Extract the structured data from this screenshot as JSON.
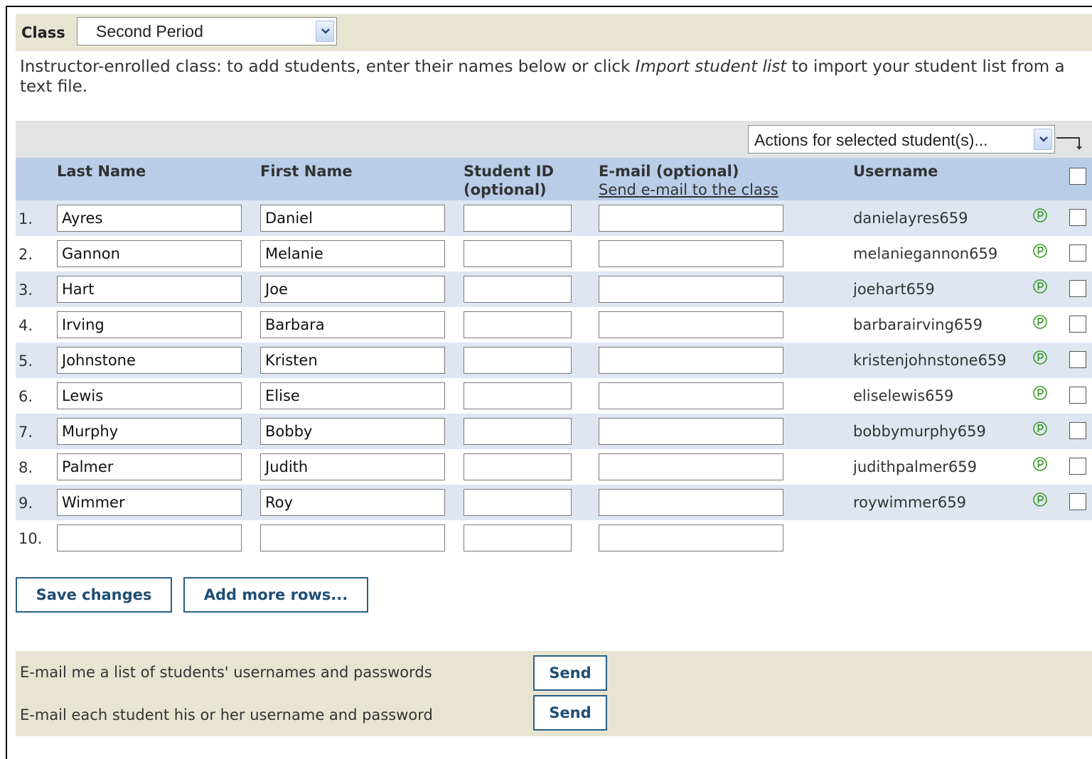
{
  "class_bar": {
    "label": "Class",
    "selected_class": "Second Period"
  },
  "intro": {
    "text_before": "Instructor-enrolled class: to add students, enter their names below or click ",
    "link_text": "Import student list",
    "text_after": " to import your student list from a text file."
  },
  "actions": {
    "select_value": "Actions for selected student(s)..."
  },
  "table": {
    "headers": {
      "last_name": "Last Name",
      "first_name": "First Name",
      "student_id_line1": "Student ID",
      "student_id_line2": "(optional)",
      "email": "E-mail (optional)",
      "send_email_link": "Send e-mail to the class",
      "username": "Username"
    },
    "rows": [
      {
        "num": "1.",
        "last": "Ayres",
        "first": "Daniel",
        "student_id": "",
        "email": "",
        "username": "danielayres659"
      },
      {
        "num": "2.",
        "last": "Gannon",
        "first": "Melanie",
        "student_id": "",
        "email": "",
        "username": "melaniegannon659"
      },
      {
        "num": "3.",
        "last": "Hart",
        "first": "Joe",
        "student_id": "",
        "email": "",
        "username": "joehart659"
      },
      {
        "num": "4.",
        "last": "Irving",
        "first": "Barbara",
        "student_id": "",
        "email": "",
        "username": "barbarairving659"
      },
      {
        "num": "5.",
        "last": "Johnstone",
        "first": "Kristen",
        "student_id": "",
        "email": "",
        "username": "kristenjohnstone659"
      },
      {
        "num": "6.",
        "last": "Lewis",
        "first": "Elise",
        "student_id": "",
        "email": "",
        "username": "eliselewis659"
      },
      {
        "num": "7.",
        "last": "Murphy",
        "first": "Bobby",
        "student_id": "",
        "email": "",
        "username": "bobbymurphy659"
      },
      {
        "num": "8.",
        "last": "Palmer",
        "first": "Judith",
        "student_id": "",
        "email": "",
        "username": "judithpalmer659"
      },
      {
        "num": "9.",
        "last": "Wimmer",
        "first": "Roy",
        "student_id": "",
        "email": "",
        "username": "roywimmer659"
      },
      {
        "num": "10.",
        "last": "",
        "first": "",
        "student_id": "",
        "email": "",
        "username": ""
      }
    ]
  },
  "buttons": {
    "save_changes": "Save changes",
    "add_more_rows": "Add more rows..."
  },
  "email_section": {
    "email_me_label": "E-mail me a list of students' usernames and passwords",
    "email_each_label": "E-mail each student his or her username and password",
    "send_label": "Send"
  },
  "colors": {
    "header_blue": "#b9cde8",
    "row_stripe": "#dfe6f2",
    "beige_bar": "#e7e5d1",
    "button_border": "#2a5f85",
    "password_icon_green": "#3c9a2a"
  }
}
